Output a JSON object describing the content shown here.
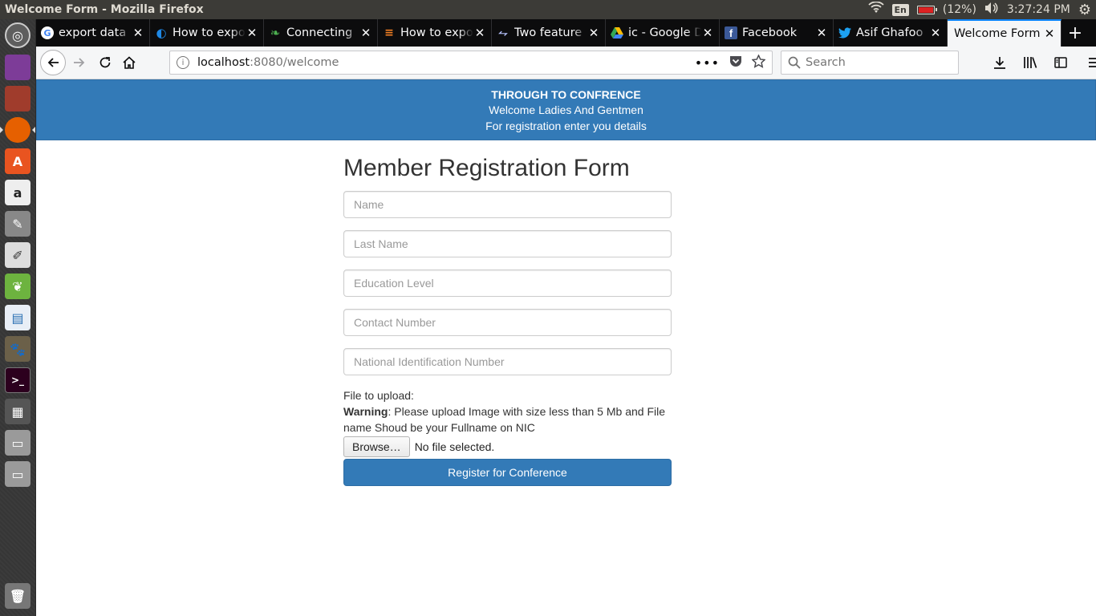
{
  "panel": {
    "window_title": "Welcome Form - Mozilla Firefox",
    "keyboard": "En",
    "battery": "(12%)",
    "clock": "3:27:24 PM"
  },
  "tabs": [
    {
      "title": "export data",
      "favicon": "google-icon",
      "color": "#ffffff"
    },
    {
      "title": "How to expo",
      "favicon": "blue-swirl-icon",
      "color": "#1e88e5"
    },
    {
      "title": "Connecting",
      "favicon": "green-leaf-icon",
      "color": "#4caf50"
    },
    {
      "title": "How to expo",
      "favicon": "stackoverflow-icon",
      "color": "#f48024"
    },
    {
      "title": "Two feature",
      "favicon": "github-icon",
      "color": "#24292e"
    },
    {
      "title": "ic - Google D",
      "favicon": "google-drive-icon",
      "color": "#fbbc04"
    },
    {
      "title": "Facebook",
      "favicon": "facebook-icon",
      "color": "#3b5998"
    },
    {
      "title": "Asif Ghafoo",
      "favicon": "twitter-icon",
      "color": "#1da1f2"
    },
    {
      "title": "Welcome Form",
      "favicon": "",
      "color": ""
    }
  ],
  "urlbar": {
    "host": "localhost",
    "rest": ":8080/welcome"
  },
  "search": {
    "placeholder": "Search"
  },
  "banner": {
    "title": "THROUGH TO CONFRENCE",
    "line1": "Welcome Ladies And Gentmen",
    "line2": "For registration enter you details"
  },
  "form": {
    "title": "Member Registration Form",
    "fields": {
      "name": "Name",
      "last_name": "Last Name",
      "education": "Education Level",
      "contact": "Contact Number",
      "nic": "National Identification Number"
    },
    "upload_label": "File to upload:",
    "warning_label": "Warning",
    "warning_text": ": Please upload Image with size less than 5 Mb and File name Shoud be your Fullname on NIC",
    "browse_label": "Browse…",
    "file_status": "No file selected.",
    "submit_label": "Register for Conference"
  },
  "colors": {
    "primary": "#337ab7",
    "tab_active_accent": "#0a84ff"
  }
}
